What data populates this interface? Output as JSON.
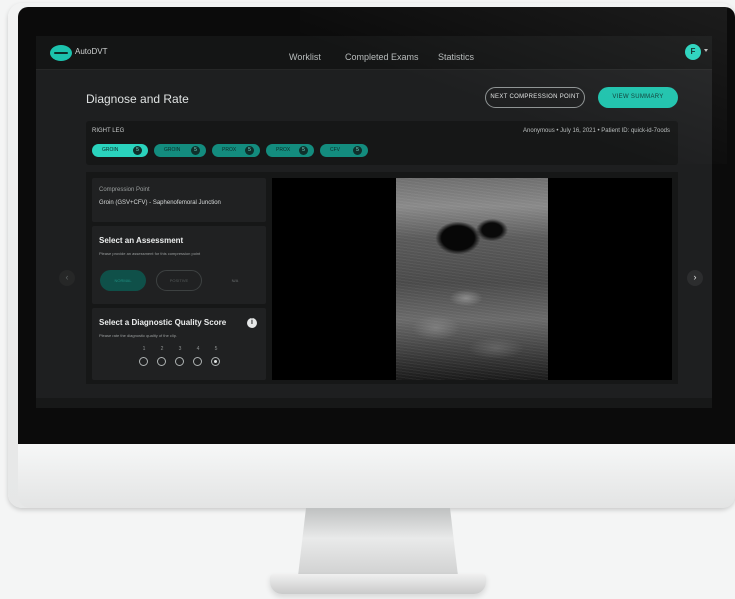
{
  "app": {
    "brand": "AutoDVT",
    "avatar_initial": "F"
  },
  "nav": {
    "items": [
      "Worklist",
      "Completed Exams",
      "Statistics"
    ]
  },
  "page": {
    "title": "Diagnose and Rate",
    "next_button": "NEXT COMPRESSION POINT",
    "summary_button": "VIEW SUMMARY"
  },
  "leg": {
    "label": "RIGHT LEG",
    "patient_info": "Anonymous  •  July 16, 2021  •  Patient ID: quick-id-7oods",
    "points": [
      {
        "label": "GROIN",
        "count": "5",
        "active": true
      },
      {
        "label": "GROIN",
        "count": "5",
        "active": false
      },
      {
        "label": "PROX",
        "count": "5",
        "active": false
      },
      {
        "label": "PROX",
        "count": "5",
        "active": false
      },
      {
        "label": "CFV",
        "count": "5",
        "active": false
      }
    ]
  },
  "compression_point": {
    "label": "Compression Point",
    "value": "Groin (GSV+CFV) - Saphenofemoral Junction"
  },
  "assessment": {
    "title": "Select an Assessment",
    "subtitle": "Please provide an assessment for this compression point",
    "options": [
      "NORMAL",
      "POSITIVE",
      "N/A"
    ]
  },
  "quality": {
    "title": "Select a Diagnostic Quality Score",
    "subtitle": "Please rate the diagnostic quality of the clip.",
    "scores": [
      "1",
      "2",
      "3",
      "4",
      "5"
    ],
    "selected": "5"
  },
  "colors": {
    "accent": "#1fc3ad",
    "accent_dim": "#138c7e",
    "screen_bg": "#1e1f20",
    "panel_bg": "#161717"
  },
  "icons": {
    "logo": "autodvt-logo-icon",
    "info": "info-icon",
    "prev": "chevron-left-icon",
    "next": "chevron-right-icon"
  }
}
